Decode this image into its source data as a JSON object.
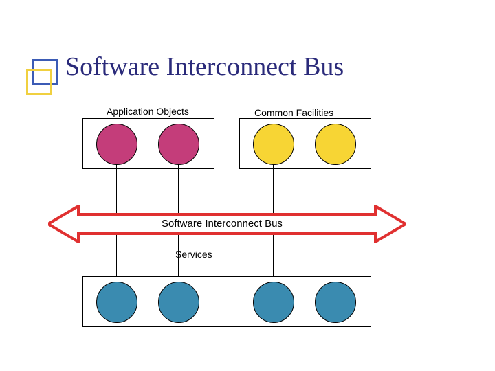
{
  "title": "Software Interconnect Bus",
  "labels": {
    "app_objects": "Application Objects",
    "common_facilities": "Common Facilities",
    "bus": "Software Interconnect Bus",
    "services": "Services"
  },
  "colors": {
    "title": "#2a2a7a",
    "bullet_blue": "#3b5bb5",
    "bullet_yellow": "#f0d040",
    "circle_magenta": "#c43d7a",
    "circle_yellow": "#f7d534",
    "circle_blue": "#3a8bb0",
    "arrow_outline": "#e03030",
    "arrow_fill": "#ffffff"
  },
  "layout": {
    "top_boxes": 2,
    "circles_per_top_box": 2,
    "bottom_circles": 4
  }
}
